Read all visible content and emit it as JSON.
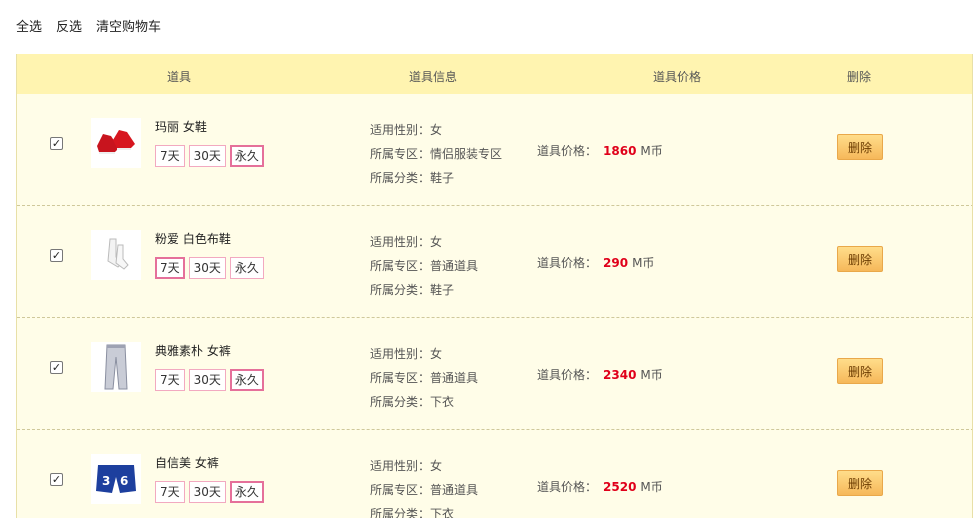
{
  "toolbar": {
    "select_all": "全选",
    "invert": "反选",
    "clear": "清空购物车"
  },
  "header": {
    "item": "道具",
    "info": "道具信息",
    "price": "道具价格",
    "delete": "删除"
  },
  "labels": {
    "gender": "适用性别：",
    "zone": "所属专区：",
    "category": "所属分类：",
    "price": "道具价格：",
    "currency": "M币",
    "delete": "删除"
  },
  "items": [
    {
      "name": "玛丽 女鞋",
      "durations": [
        "7天",
        "30天",
        "永久"
      ],
      "selected": 2,
      "gender": "女",
      "zone": "情侣服装专区",
      "category": "鞋子",
      "price": "1860",
      "icon": "red-sneakers-icon",
      "checked": true
    },
    {
      "name": "粉爱 白色布鞋",
      "durations": [
        "7天",
        "30天",
        "永久"
      ],
      "selected": 0,
      "gender": "女",
      "zone": "普通道具",
      "category": "鞋子",
      "price": "290",
      "icon": "white-socks-icon",
      "checked": true
    },
    {
      "name": "典雅素朴 女裤",
      "durations": [
        "7天",
        "30天",
        "永久"
      ],
      "selected": 2,
      "gender": "女",
      "zone": "普通道具",
      "category": "下衣",
      "price": "2340",
      "icon": "silver-pants-icon",
      "checked": true
    },
    {
      "name": "自信美 女裤",
      "durations": [
        "7天",
        "30天",
        "永久"
      ],
      "selected": 2,
      "gender": "女",
      "zone": "普通道具",
      "category": "下衣",
      "price": "2520",
      "icon": "blue-shorts-icon",
      "checked": true
    }
  ]
}
